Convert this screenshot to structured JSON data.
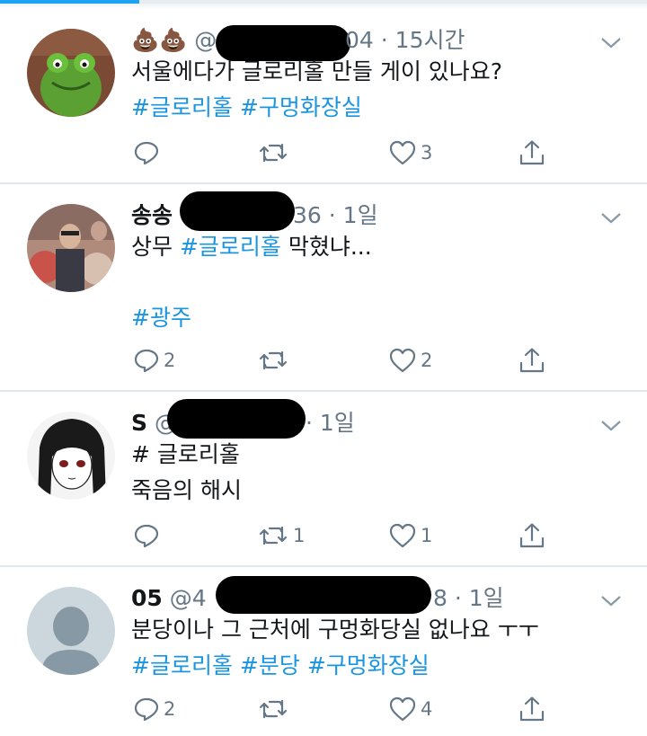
{
  "tweets": [
    {
      "display_name": "💩💩",
      "handle_prefix": "@",
      "handle_suffix": "04",
      "time": "15시간",
      "text_plain": "서울에다가 ",
      "text_tag": "글로리홀",
      "text_after": " 만들 게이 있나요?",
      "hashtags": [
        "#글로리홀",
        "#구멍화장실"
      ],
      "replies": "",
      "retweets": "",
      "likes": "3"
    },
    {
      "display_name": "송송",
      "handle_prefix": "",
      "handle_suffix": "36",
      "time": "1일",
      "text_plain": "상무 ",
      "text_tag": "#글로리홀",
      "text_after": " 막혔냐...",
      "hashtag_line": "#광주",
      "replies": "2",
      "retweets": "",
      "likes": "2"
    },
    {
      "display_name": "S",
      "handle_prefix": "@",
      "handle_suffix": "",
      "time": "1일",
      "line1": "# 글로리홀",
      "line2": "죽음의 해시",
      "replies": "",
      "retweets": "1",
      "likes": "1"
    },
    {
      "display_name": "05",
      "handle_prefix": "@4",
      "handle_suffix": "8",
      "time": "1일",
      "text": "분당이나 그 근처에 구멍화당실 없나요 ㅜㅜ",
      "hashtags": [
        "#글로리홀",
        "#분당",
        "#구멍화장실"
      ],
      "replies": "2",
      "retweets": "",
      "likes": "4"
    }
  ],
  "icons": [
    "reply-icon",
    "retweet-icon",
    "like-icon",
    "share-icon",
    "chevron-down-icon"
  ],
  "colors": {
    "accent": "#1da1f2",
    "hashtag": "#1b95e0",
    "muted": "#657786",
    "divider": "#e1e8ed"
  }
}
